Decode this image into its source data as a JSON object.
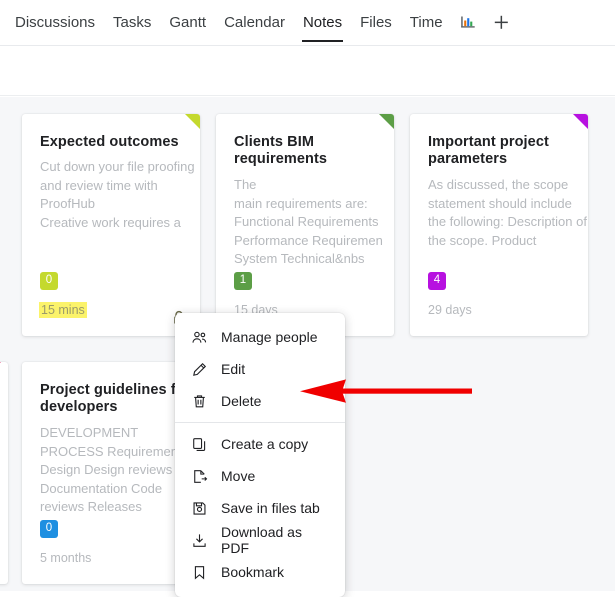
{
  "nav": {
    "tabs": [
      {
        "label": "Discussions",
        "active": false
      },
      {
        "label": "Tasks",
        "active": false
      },
      {
        "label": "Gantt",
        "active": false
      },
      {
        "label": "Calendar",
        "active": false
      },
      {
        "label": "Notes",
        "active": true
      },
      {
        "label": "Files",
        "active": false
      },
      {
        "label": "Time",
        "active": false
      }
    ],
    "chart_icon": "bar-chart-icon",
    "add_icon": "plus-icon"
  },
  "cards": [
    {
      "title": "Expected outcomes",
      "body": "Cut down your file proofing and review time with ProofHub\nCreative work requires a",
      "badge": "0",
      "badge_color": "#c4d92e",
      "corner_color": "#c4d92e",
      "meta": "15 mins",
      "meta_highlighted": true,
      "locked": true
    },
    {
      "title": "Clients BIM requirements",
      "body": "The\nmain requirements are:\nFunctional Requirements\nPerformance Requiremen\nSystem Technical&nbs",
      "badge": "1",
      "badge_color": "#5c9e46",
      "corner_color": "#5c9e46",
      "meta": "15 days",
      "meta_highlighted": false,
      "locked": false
    },
    {
      "title": "Important project parameters",
      "body": "As discussed, the scope statement should include the following: Description of the scope. Product",
      "badge": "4",
      "badge_color": "#b711e0",
      "corner_color": "#b711e0",
      "meta": "29 days",
      "meta_highlighted": false,
      "locked": false
    },
    {
      "title": "Project guidelines for developers",
      "body": "DEVELOPMENT PROCESS  Requirement Design Design reviews Documentation Code reviews Releases",
      "badge": "0",
      "badge_color": "#1e8fe1",
      "corner_color": "#1e8fe1",
      "meta": "5 months",
      "meta_highlighted": false,
      "locked": false
    }
  ],
  "partial_card": {
    "corner_color": "#e8447a"
  },
  "context_menu": {
    "items": [
      {
        "label": "Manage people",
        "icon": "people-icon"
      },
      {
        "label": "Edit",
        "icon": "pencil-icon"
      },
      {
        "label": "Delete",
        "icon": "trash-icon"
      },
      {
        "label": "Create a copy",
        "icon": "copy-icon"
      },
      {
        "label": "Move",
        "icon": "move-icon"
      },
      {
        "label": "Save in files tab",
        "icon": "save-disk-icon"
      },
      {
        "label": "Download as PDF",
        "icon": "download-icon"
      },
      {
        "label": "Bookmark",
        "icon": "bookmark-icon"
      }
    ]
  },
  "annotation": {
    "arrow_color": "#f00000",
    "points_to": "Delete"
  }
}
